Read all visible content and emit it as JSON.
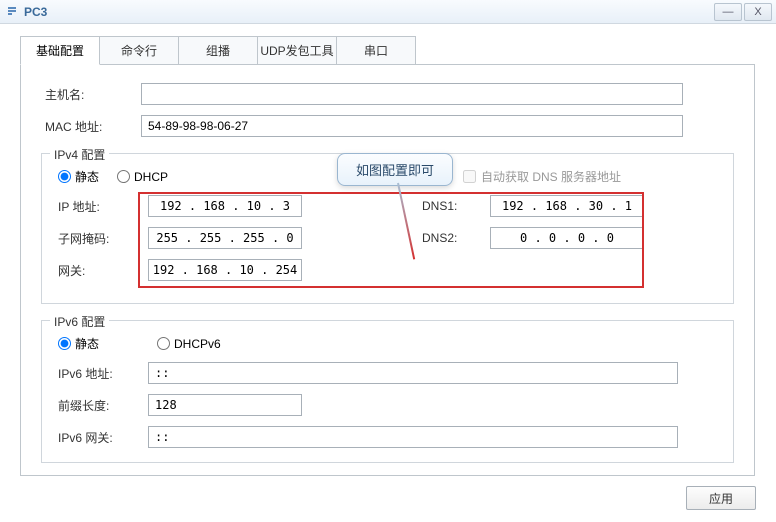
{
  "window": {
    "title": "PC3",
    "minimize": "—",
    "close": "X"
  },
  "tabs": {
    "basic": "基础配置",
    "cli": "命令行",
    "multicast": "组播",
    "udp": "UDP发包工具",
    "serial": "串口"
  },
  "form": {
    "hostname_label": "主机名:",
    "hostname_value": "",
    "mac_label": "MAC 地址:",
    "mac_value": "54-89-98-98-06-27"
  },
  "ipv4": {
    "legend": "IPv4 配置",
    "static": "静态",
    "dhcp": "DHCP",
    "auto_dns": "自动获取 DNS 服务器地址",
    "ip_label": "IP 地址:",
    "ip_value": "192  .  168  .   10   .    3",
    "mask_label": "子网掩码:",
    "mask_value": "255  .  255  .  255  .    0",
    "gateway_label": "网关:",
    "gateway_value": "192  .  168  .   10  .  254",
    "dns1_label": "DNS1:",
    "dns1_value": "192  .  168  .   30   .    1",
    "dns2_label": "DNS2:",
    "dns2_value": "  0   .    0   .    0   .    0"
  },
  "ipv6": {
    "legend": "IPv6 配置",
    "static": "静态",
    "dhcpv6": "DHCPv6",
    "addr_label": "IPv6 地址:",
    "addr_value": "::",
    "prefix_label": "前缀长度:",
    "prefix_value": "128",
    "gateway_label": "IPv6 网关:",
    "gateway_value": "::"
  },
  "callout": "如图配置即可",
  "apply": "应用"
}
